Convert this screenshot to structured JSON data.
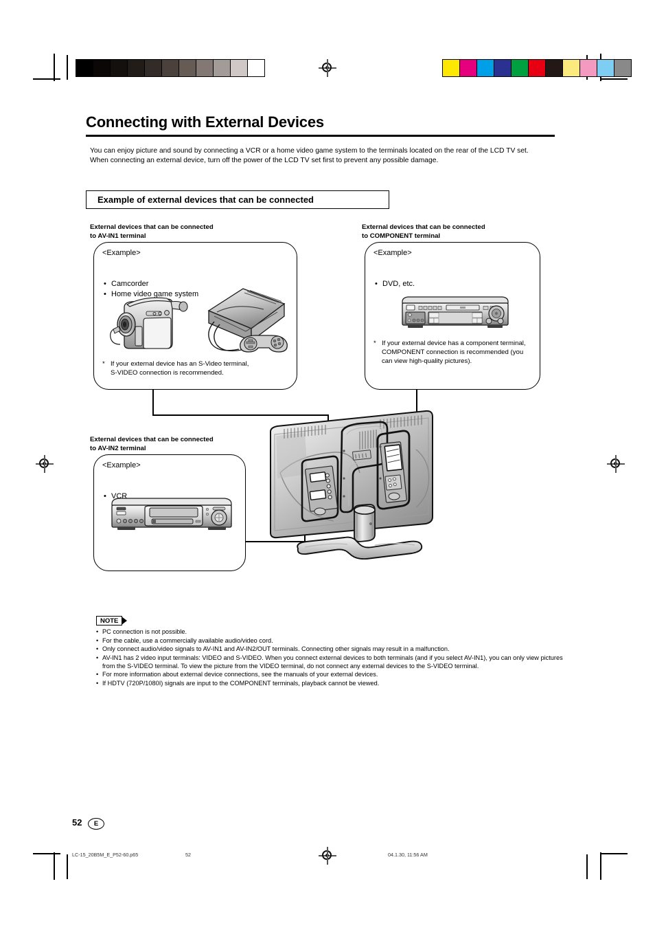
{
  "document": {
    "title": "Connecting with External Devices",
    "intro": "You can enjoy picture and sound by connecting a VCR or a home video game system to the terminals located on the rear of the LCD TV set.\nWhen connecting an external device, turn off the power of the LCD TV set first to prevent any possible damage.",
    "section_heading": "Example of external devices that can be connected"
  },
  "av_in1": {
    "caption": "External devices that can be connected\nto AV-IN1 terminal",
    "example_label": "<Example>",
    "items": [
      "Camcorder",
      "Home video game system"
    ],
    "footnote": "If your external device has an S-Video terminal,\nS-VIDEO connection is recommended."
  },
  "component": {
    "caption": "External devices that can be connected\nto COMPONENT terminal",
    "example_label": "<Example>",
    "items": [
      "DVD, etc."
    ],
    "footnote": "If your external device has a component terminal,\nCOMPONENT connection is recommended (you\ncan view high-quality pictures)."
  },
  "av_in2": {
    "caption": "External devices that can be connected\nto AV-IN2 terminal",
    "example_label": "<Example>",
    "items": [
      "VCR"
    ]
  },
  "note": {
    "label": "NOTE",
    "items": [
      "PC connection is not possible.",
      "For the cable, use a commercially available audio/video cord.",
      "Only connect audio/video signals to AV-IN1 and AV-IN2/OUT terminals. Connecting other signals may result in a malfunction.",
      "AV-IN1 has 2 video input terminals: VIDEO and S-VIDEO. When you connect external devices to both terminals (and if you select AV-IN1), you can only view pictures from the S-VIDEO terminal. To view the picture from the VIDEO terminal, do not connect any external devices to the S-VIDEO terminal.",
      "For more information about external device connections, see the manuals of your external devices.",
      "If HDTV (720P/1080I) signals are input to the COMPONENT terminals, playback cannot be viewed."
    ]
  },
  "footer": {
    "page_number": "52",
    "language_code": "E",
    "file_name": "LC-15_20B5M_E_P52-60.p65",
    "print_page": "52",
    "timestamp": "04.1.30, 11:56 AM"
  },
  "calibration": {
    "grayscale": [
      "#000000",
      "#0a0706",
      "#14100e",
      "#221c19",
      "#332b27",
      "#4b413c",
      "#665b55",
      "#837874",
      "#a39b98",
      "#cfc8c6",
      "#ffffff"
    ],
    "color": [
      "#ffe800",
      "#e6007e",
      "#00a0e9",
      "#2b3190",
      "#00a040",
      "#e60012",
      "#231815",
      "#fbea7d",
      "#f49ac1",
      "#7ecef4",
      "#898989"
    ]
  }
}
